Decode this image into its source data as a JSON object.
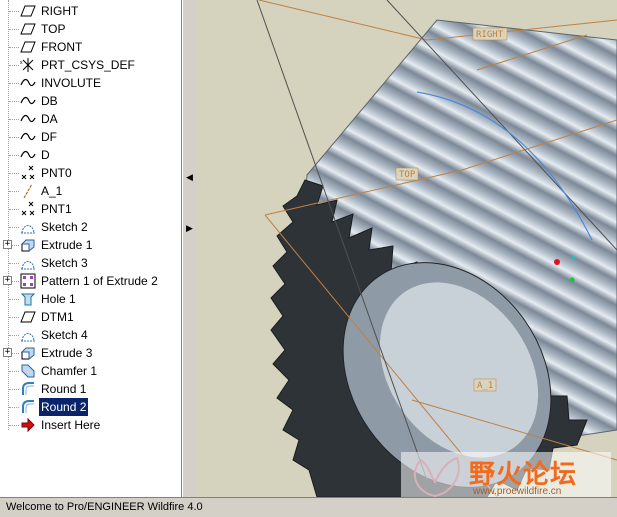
{
  "model_tree": {
    "items": [
      {
        "label": "RIGHT",
        "icon": "datum-plane-icon",
        "expandable": false
      },
      {
        "label": "TOP",
        "icon": "datum-plane-icon",
        "expandable": false
      },
      {
        "label": "FRONT",
        "icon": "datum-plane-icon",
        "expandable": false
      },
      {
        "label": "PRT_CSYS_DEF",
        "icon": "coordinate-system-icon",
        "expandable": false
      },
      {
        "label": "INVOLUTE",
        "icon": "datum-curve-icon",
        "expandable": false
      },
      {
        "label": "DB",
        "icon": "datum-curve-icon",
        "expandable": false
      },
      {
        "label": "DA",
        "icon": "datum-curve-icon",
        "expandable": false
      },
      {
        "label": "DF",
        "icon": "datum-curve-icon",
        "expandable": false
      },
      {
        "label": "D",
        "icon": "datum-curve-icon",
        "expandable": false
      },
      {
        "label": "PNT0",
        "icon": "datum-point-icon",
        "expandable": false
      },
      {
        "label": "A_1",
        "icon": "datum-axis-icon",
        "expandable": false
      },
      {
        "label": "PNT1",
        "icon": "datum-point-icon",
        "expandable": false
      },
      {
        "label": "Sketch 2",
        "icon": "sketch-icon",
        "expandable": false
      },
      {
        "label": "Extrude 1",
        "icon": "extrude-icon",
        "expandable": true
      },
      {
        "label": "Sketch 3",
        "icon": "sketch-icon",
        "expandable": false
      },
      {
        "label": "Pattern 1 of Extrude 2",
        "icon": "pattern-icon",
        "expandable": true
      },
      {
        "label": "Hole 1",
        "icon": "hole-icon",
        "expandable": false
      },
      {
        "label": "DTM1",
        "icon": "datum-plane-icon",
        "expandable": false
      },
      {
        "label": "Sketch 4",
        "icon": "sketch-icon",
        "expandable": false
      },
      {
        "label": "Extrude 3",
        "icon": "extrude-icon",
        "expandable": true
      },
      {
        "label": "Chamfer 1",
        "icon": "chamfer-icon",
        "expandable": false
      },
      {
        "label": "Round 1",
        "icon": "round-icon",
        "expandable": false
      },
      {
        "label": "Round 2",
        "icon": "round-icon",
        "expandable": false,
        "selected": true
      },
      {
        "label": "Insert Here",
        "icon": "insert-here-arrow-icon",
        "expandable": false
      }
    ]
  },
  "viewport": {
    "datum_labels": {
      "right": "RIGHT",
      "top": "TOP",
      "axis": "A_1"
    }
  },
  "statusbar": {
    "text": "Welcome to Pro/ENGINEER Wildfire 4.0"
  },
  "watermark": {
    "title": "野火论坛",
    "url": "www.proewildfire.cn"
  },
  "colors": {
    "selection": "#0a246a",
    "datum": "#c08040",
    "viewport_bg": "#d5d3bd",
    "gear_body": "#b8c2cc"
  }
}
